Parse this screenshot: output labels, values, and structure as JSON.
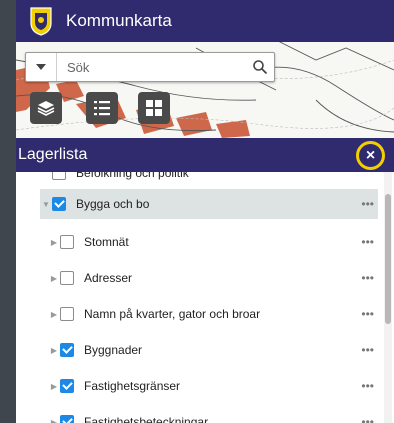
{
  "header": {
    "title": "Kommunkarta",
    "logo_icon": "municipal-crest-icon"
  },
  "search": {
    "placeholder": "Sök",
    "value": ""
  },
  "tools": {
    "layers_icon": "layers-icon",
    "list_icon": "list-icon",
    "grid_icon": "grid-icon"
  },
  "panel": {
    "title": "Lagerlista",
    "close_label": "×",
    "items": [
      {
        "label": "Befolkning och politik",
        "checked": false,
        "level": 1
      },
      {
        "label": "Bygga och bo",
        "checked": true,
        "level": 1,
        "expanded": true,
        "more": "•••"
      },
      {
        "label": "Stomnät",
        "checked": false,
        "level": 2,
        "more": "•••"
      },
      {
        "label": "Adresser",
        "checked": false,
        "level": 2,
        "more": "•••"
      },
      {
        "label": "Namn på kvarter, gator och broar",
        "checked": false,
        "level": 2,
        "more": "•••"
      },
      {
        "label": "Byggnader",
        "checked": true,
        "level": 2,
        "more": "•••"
      },
      {
        "label": "Fastighetsgränser",
        "checked": true,
        "level": 2,
        "more": "•••"
      },
      {
        "label": "Fastighetsbeteckningar",
        "checked": true,
        "level": 2,
        "more": "•••"
      }
    ]
  },
  "colors": {
    "brand": "#2f2b6e",
    "accent": "#1e88e5",
    "highlight": "#f2cf00"
  }
}
